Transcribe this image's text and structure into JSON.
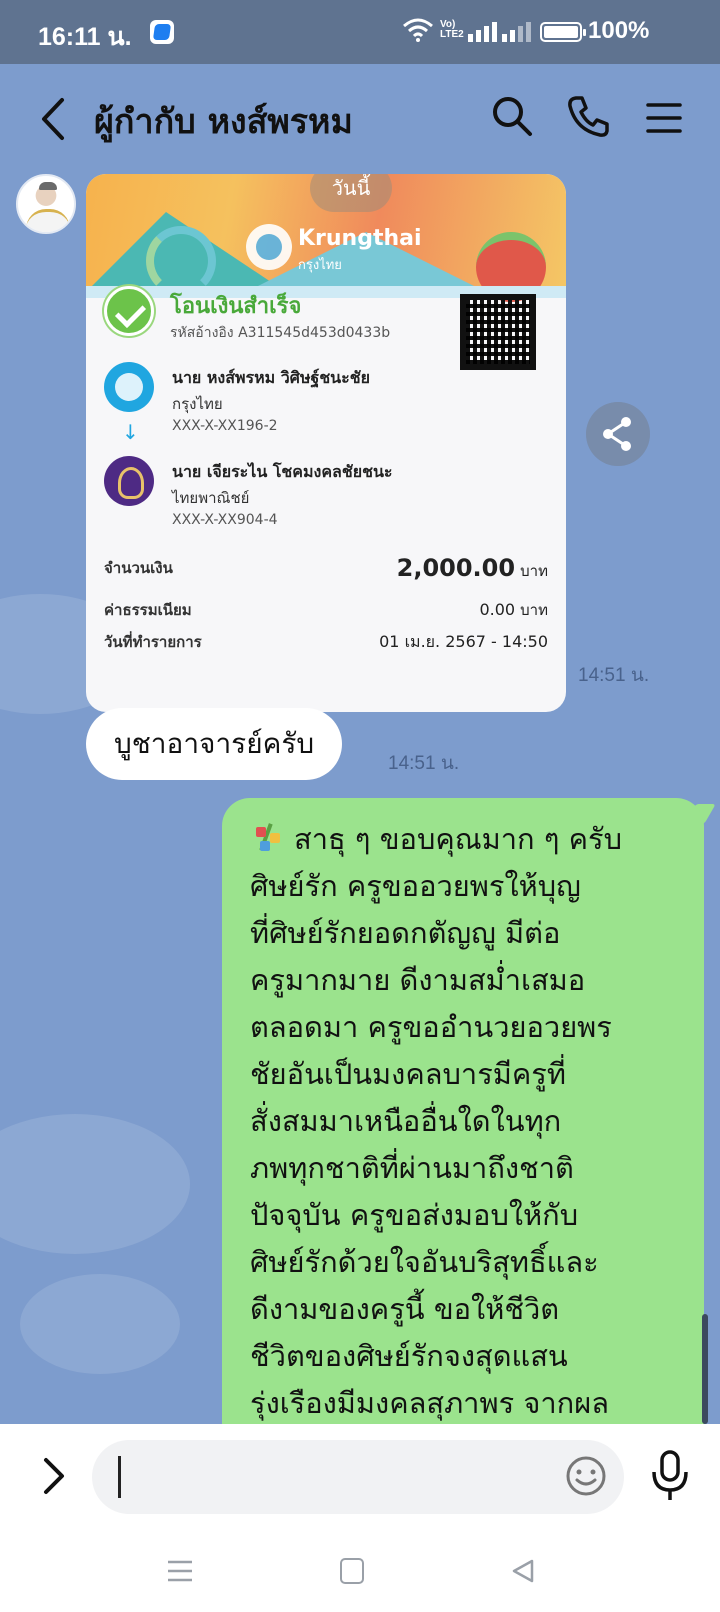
{
  "status_bar": {
    "time": "16:11 น.",
    "volte_top": "Vo)",
    "volte_bottom": "LTE2",
    "battery": "100%"
  },
  "header": {
    "title": "ผู้กำกับ หงส์พรหม",
    "icons": [
      "back-arrow-icon",
      "search-icon",
      "phone-icon",
      "menu-icon"
    ]
  },
  "chat": {
    "date_divider": "วันนี้",
    "slip": {
      "bank_brand": "Krungthai",
      "bank_brand_th": "กรุงไทย",
      "status": "โอนเงินสำเร็จ",
      "reference": "รหัสอ้างอิง A311545d453d0433b",
      "sender": {
        "name": "นาย หงส์พรหม วิศิษฐ์ชนะชัย",
        "bank": "กรุงไทย",
        "account": "XXX-X-XX196-2"
      },
      "receiver": {
        "name": "นาย เจียระไน โชคมงคลชัยชนะ",
        "bank": "ไทยพาณิชย์",
        "account": "XXX-X-XX904-4"
      },
      "amount_label": "จำนวนเงิน",
      "amount_value": "2,000.00",
      "fee_label": "ค่าธรรมเนียม",
      "fee_value": "0.00",
      "date_label": "วันที่ทำรายการ",
      "date_value": "01 เม.ย. 2567 - 14:50",
      "currency_unit": "บาท",
      "time": "14:51 น."
    },
    "message_in": {
      "text": "บูชาอาจารย์ครับ",
      "time": "14:51 น."
    },
    "message_out": {
      "lines": [
        "สาธุ ๆ ขอบคุณมาก ๆ ครับ",
        "ศิษย์รัก ครูขออวยพรให้บุญ",
        "ที่ศิษย์รักยอดกตัญญู มีต่อ",
        "ครูมากมาย ดีงามสม่ำเสมอ",
        "ตลอดมา ครูขออำนวยอวยพร",
        "ชัยอันเป็นมงคลบารมีครูที่",
        "สั่งสมมาเหนืออื่นใดในทุก",
        "ภพทุกชาติที่ผ่านมาถึงชาติ",
        "ปัจจุบัน ครูขอส่งมอบให้กับ",
        "ศิษย์รักด้วยใจอันบริสุทธิ์และ",
        "ดีงามของครูนี้ ขอให้ชีวิต",
        "ชีวิตของศิษย์รักจงสุดแสน",
        "รุ่งเรืองมีมงคลสุภาพร จากผล"
      ]
    }
  },
  "input": {
    "value": "",
    "icons": [
      "expand-icon",
      "emoji-icon",
      "microphone-icon"
    ]
  },
  "colors": {
    "chat_background": "#7d9ccd",
    "outgoing_bubble": "#9be38d",
    "status_bar": "#5f7390"
  }
}
